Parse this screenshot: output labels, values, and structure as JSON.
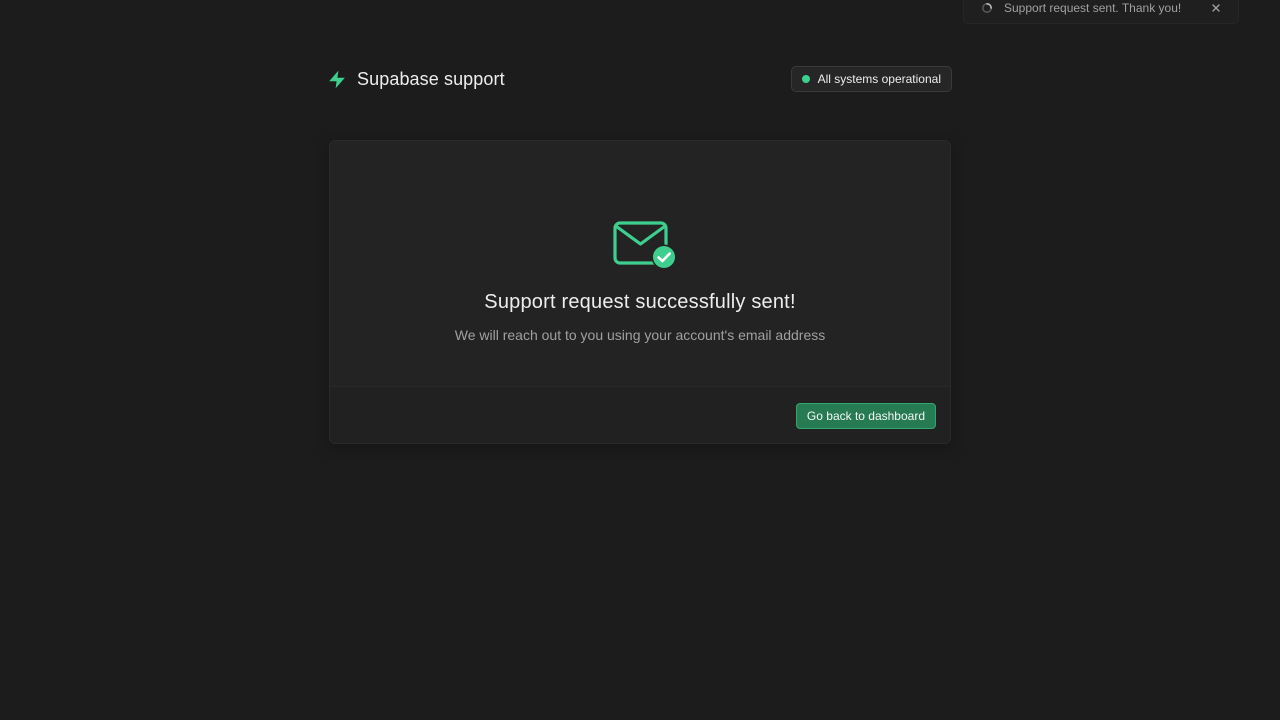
{
  "toast": {
    "message": "Support request sent. Thank you!",
    "spinner_icon": "spinner-icon",
    "close_icon": "close-icon"
  },
  "header": {
    "logo_icon": "supabase-bolt-icon",
    "title": "Supabase support",
    "status": {
      "label": "All systems operational",
      "color": "#3ecf8e"
    }
  },
  "card": {
    "icon": "mail-check-icon",
    "title": "Support request successfully sent!",
    "description": "We will reach out to you using your account's email address",
    "button_label": "Go back to dashboard"
  },
  "colors": {
    "background": "#1c1c1c",
    "accent": "#3ecf8e",
    "button": "#267b53"
  }
}
